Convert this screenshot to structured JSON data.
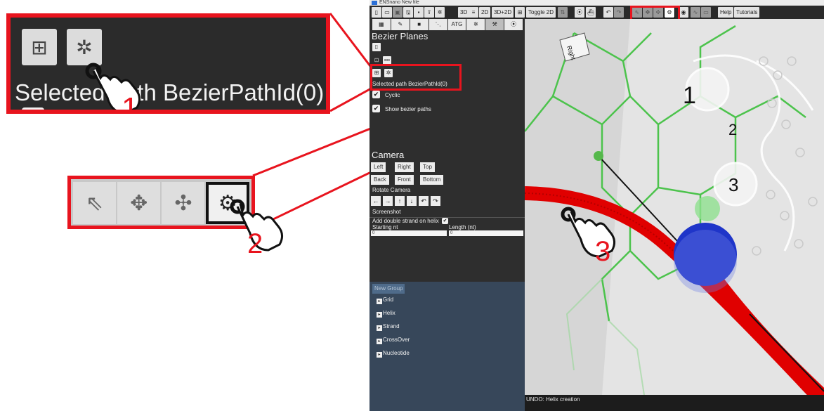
{
  "window": {
    "title": "ENSnano New file"
  },
  "toolbar": {
    "buttons_3d": "3D",
    "buttons_2d": "2D",
    "buttons_3d2d": "3D+2D",
    "toggle_2d": "Toggle 2D",
    "help": "Help",
    "tutorials": "Tutorials",
    "atg_tab": "ATG"
  },
  "panel": {
    "section_title": "Bezier Planes",
    "selected_path": "Selected path BezierPathId(0)",
    "cyclic_label": "Cyclic",
    "show_bezier_label": "Show bezier paths",
    "camera_title": "Camera",
    "camera_buttons": [
      "Left",
      "Right",
      "Top",
      "Back",
      "Front",
      "Bottom"
    ],
    "rotate_camera_label": "Rotate Camera",
    "rotate_arrows": [
      "←",
      "→",
      "↑",
      "↓",
      "↶",
      "↷"
    ],
    "screenshot_label": "Screenshot",
    "add_double_strand_label": "Add double strand on helix",
    "starting_nt_label": "Starting nt",
    "length_label": "Length (nt)",
    "starting_nt_value": "0",
    "length_value": "0"
  },
  "tree": {
    "new_group": "New Group",
    "items": [
      "Grid",
      "Helix",
      "Strand",
      "CrossOver",
      "Nucleotide"
    ]
  },
  "viewport": {
    "plane_label": "Right",
    "step_numbers": [
      "1",
      "2",
      "3"
    ]
  },
  "status": {
    "text": "UNDO: Helix creation"
  },
  "callouts": {
    "zoom1_label": "Selected path BezierPathId(0)",
    "step1": "1",
    "step2": "2",
    "step3": "3"
  },
  "colors": {
    "callout_red": "#e8141e",
    "panel_bg": "#2e2e2e",
    "grid_green": "#4cc34c",
    "helix_red": "#e00000",
    "sphere_blue": "#1f35c9"
  }
}
